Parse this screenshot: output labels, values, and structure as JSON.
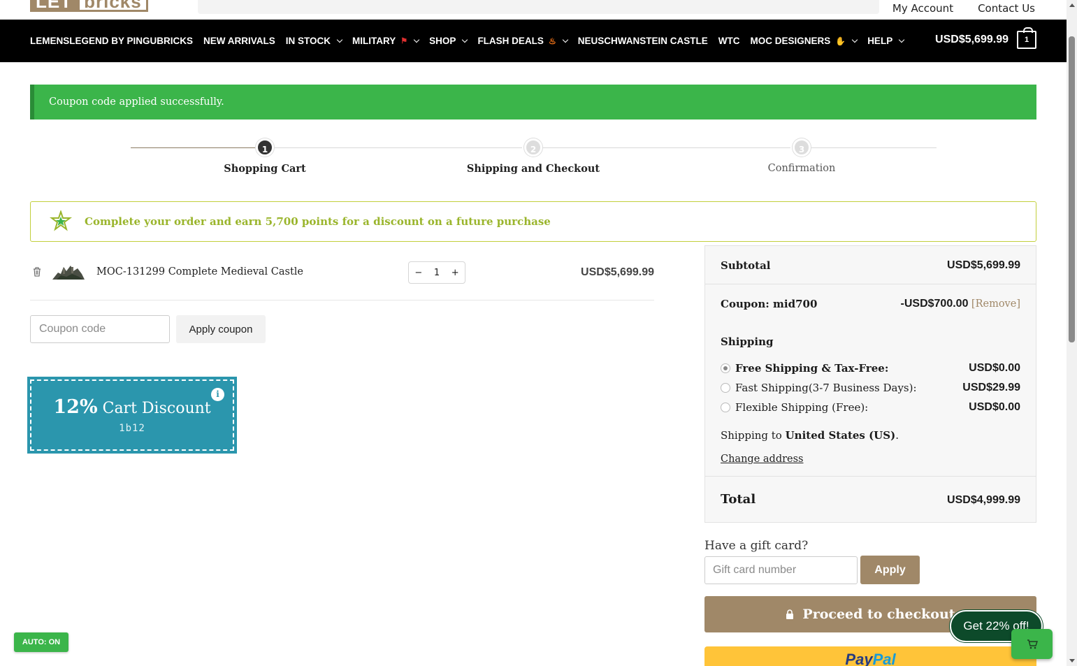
{
  "brand": {
    "logo_part1": "LET",
    "logo_part2": "bricks"
  },
  "header": {
    "links": [
      "My Account",
      "Contact Us"
    ]
  },
  "nav": {
    "items": [
      {
        "label": "LEMENSLEGEND BY PINGUBRICKS",
        "dropdown": false,
        "emoji": ""
      },
      {
        "label": "NEW ARRIVALS",
        "dropdown": false,
        "emoji": ""
      },
      {
        "label": "IN STOCK",
        "dropdown": true,
        "emoji": ""
      },
      {
        "label": "MILITARY",
        "dropdown": true,
        "emoji": "flag-icon"
      },
      {
        "label": "SHOP",
        "dropdown": true,
        "emoji": ""
      },
      {
        "label": "FLASH DEALS",
        "dropdown": true,
        "emoji": "fire-icon"
      },
      {
        "label": "NEUSCHWANSTEIN CASTLE",
        "dropdown": false,
        "emoji": ""
      },
      {
        "label": "WTC",
        "dropdown": false,
        "emoji": ""
      },
      {
        "label": "MOC DESIGNERS",
        "dropdown": true,
        "emoji": "thumbs-up-icon"
      },
      {
        "label": "HELP",
        "dropdown": true,
        "emoji": ""
      }
    ],
    "cart_total": "USD$5,699.99",
    "cart_count": "1"
  },
  "notice": {
    "text": "Coupon code applied successfully."
  },
  "steps": [
    {
      "number": "1",
      "label": "Shopping Cart",
      "active": true
    },
    {
      "number": "2",
      "label": "Shipping and Checkout",
      "active": false
    },
    {
      "number": "3",
      "label": "Confirmation",
      "active": false
    }
  ],
  "points": {
    "text": "Complete your order and earn 5,700 points for a discount on a future purchase"
  },
  "cart": {
    "item": {
      "name": "MOC-131299 Complete Medieval Castle",
      "qty": "1",
      "minus": "−",
      "plus": "+",
      "price": "USD$5,699.99"
    },
    "coupon_placeholder": "Coupon code",
    "apply_coupon": "Apply coupon"
  },
  "promo": {
    "percent": "12%",
    "label": "Cart Discount",
    "code": "1b12",
    "info": "i"
  },
  "summary": {
    "subtotal_label": "Subtotal",
    "subtotal_value": "USD$5,699.99",
    "coupon_label": "Coupon: mid700",
    "coupon_value": "-USD$700.00",
    "coupon_remove": "[Remove]",
    "shipping_label": "Shipping",
    "shipping_options": [
      {
        "label": "Free Shipping & Tax-Free:",
        "price": "USD$0.00",
        "selected": true
      },
      {
        "label": "Fast Shipping(3-7 Business Days):",
        "price": "USD$29.99",
        "selected": false
      },
      {
        "label": "Flexible Shipping (Free):",
        "price": "USD$0.00",
        "selected": false
      }
    ],
    "ship_to_prefix": "Shipping to ",
    "ship_to_country": "United States (US)",
    "ship_to_suffix": ".",
    "change_address": "Change address",
    "total_label": "Total",
    "total_value": "USD$4,999.99"
  },
  "gift": {
    "label": "Have a gift card?",
    "placeholder": "Gift card number",
    "apply": "Apply"
  },
  "checkout": {
    "label": "Proceed to checkout"
  },
  "paypal": {
    "part1": "Pay",
    "part2": "Pal"
  },
  "floating": {
    "get_offer": "Get 22% off!",
    "auto": "AUTO: ON"
  },
  "colors": {
    "accent": "#a08868",
    "success": "#3bb54a",
    "promo": "#2b96ad",
    "points": "#9ab52c"
  }
}
